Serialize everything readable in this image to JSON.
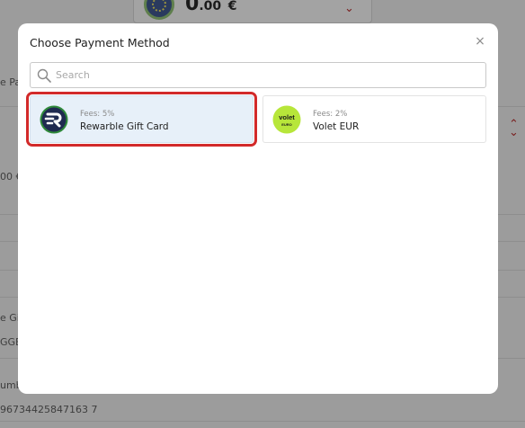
{
  "background": {
    "balance": {
      "amount_main": "0",
      "amount_decimals": ".00",
      "currency_symbol": "€"
    },
    "partial_texts": {
      "pay_label": "e Pa",
      "amount_value": "00 €",
      "gift_label": "e Gift",
      "gift_code": "GGB",
      "number_label": "umbe",
      "number_value": "96734425847163 7"
    }
  },
  "modal": {
    "title": "Choose Payment Method",
    "close_glyph": "×",
    "search": {
      "placeholder": "Search",
      "value": ""
    },
    "options": [
      {
        "fees": "Fees: 5%",
        "name": "Rewarble Gift Card",
        "icon": "rewarble-logo-icon",
        "selected": true,
        "highlighted": true
      },
      {
        "fees": "Fees: 2%",
        "name": "Volet EUR",
        "icon": "volet-logo-icon",
        "logo_text_top": "volet",
        "logo_text_bottom": "EURO",
        "selected": false
      }
    ]
  },
  "colors": {
    "highlight_border": "#d22a2a",
    "selected_bg": "#e7f0f9",
    "rewarble_ring": "#2f8a3a",
    "rewarble_bg": "#1f2a50",
    "volet_green": "#b7e63a"
  }
}
